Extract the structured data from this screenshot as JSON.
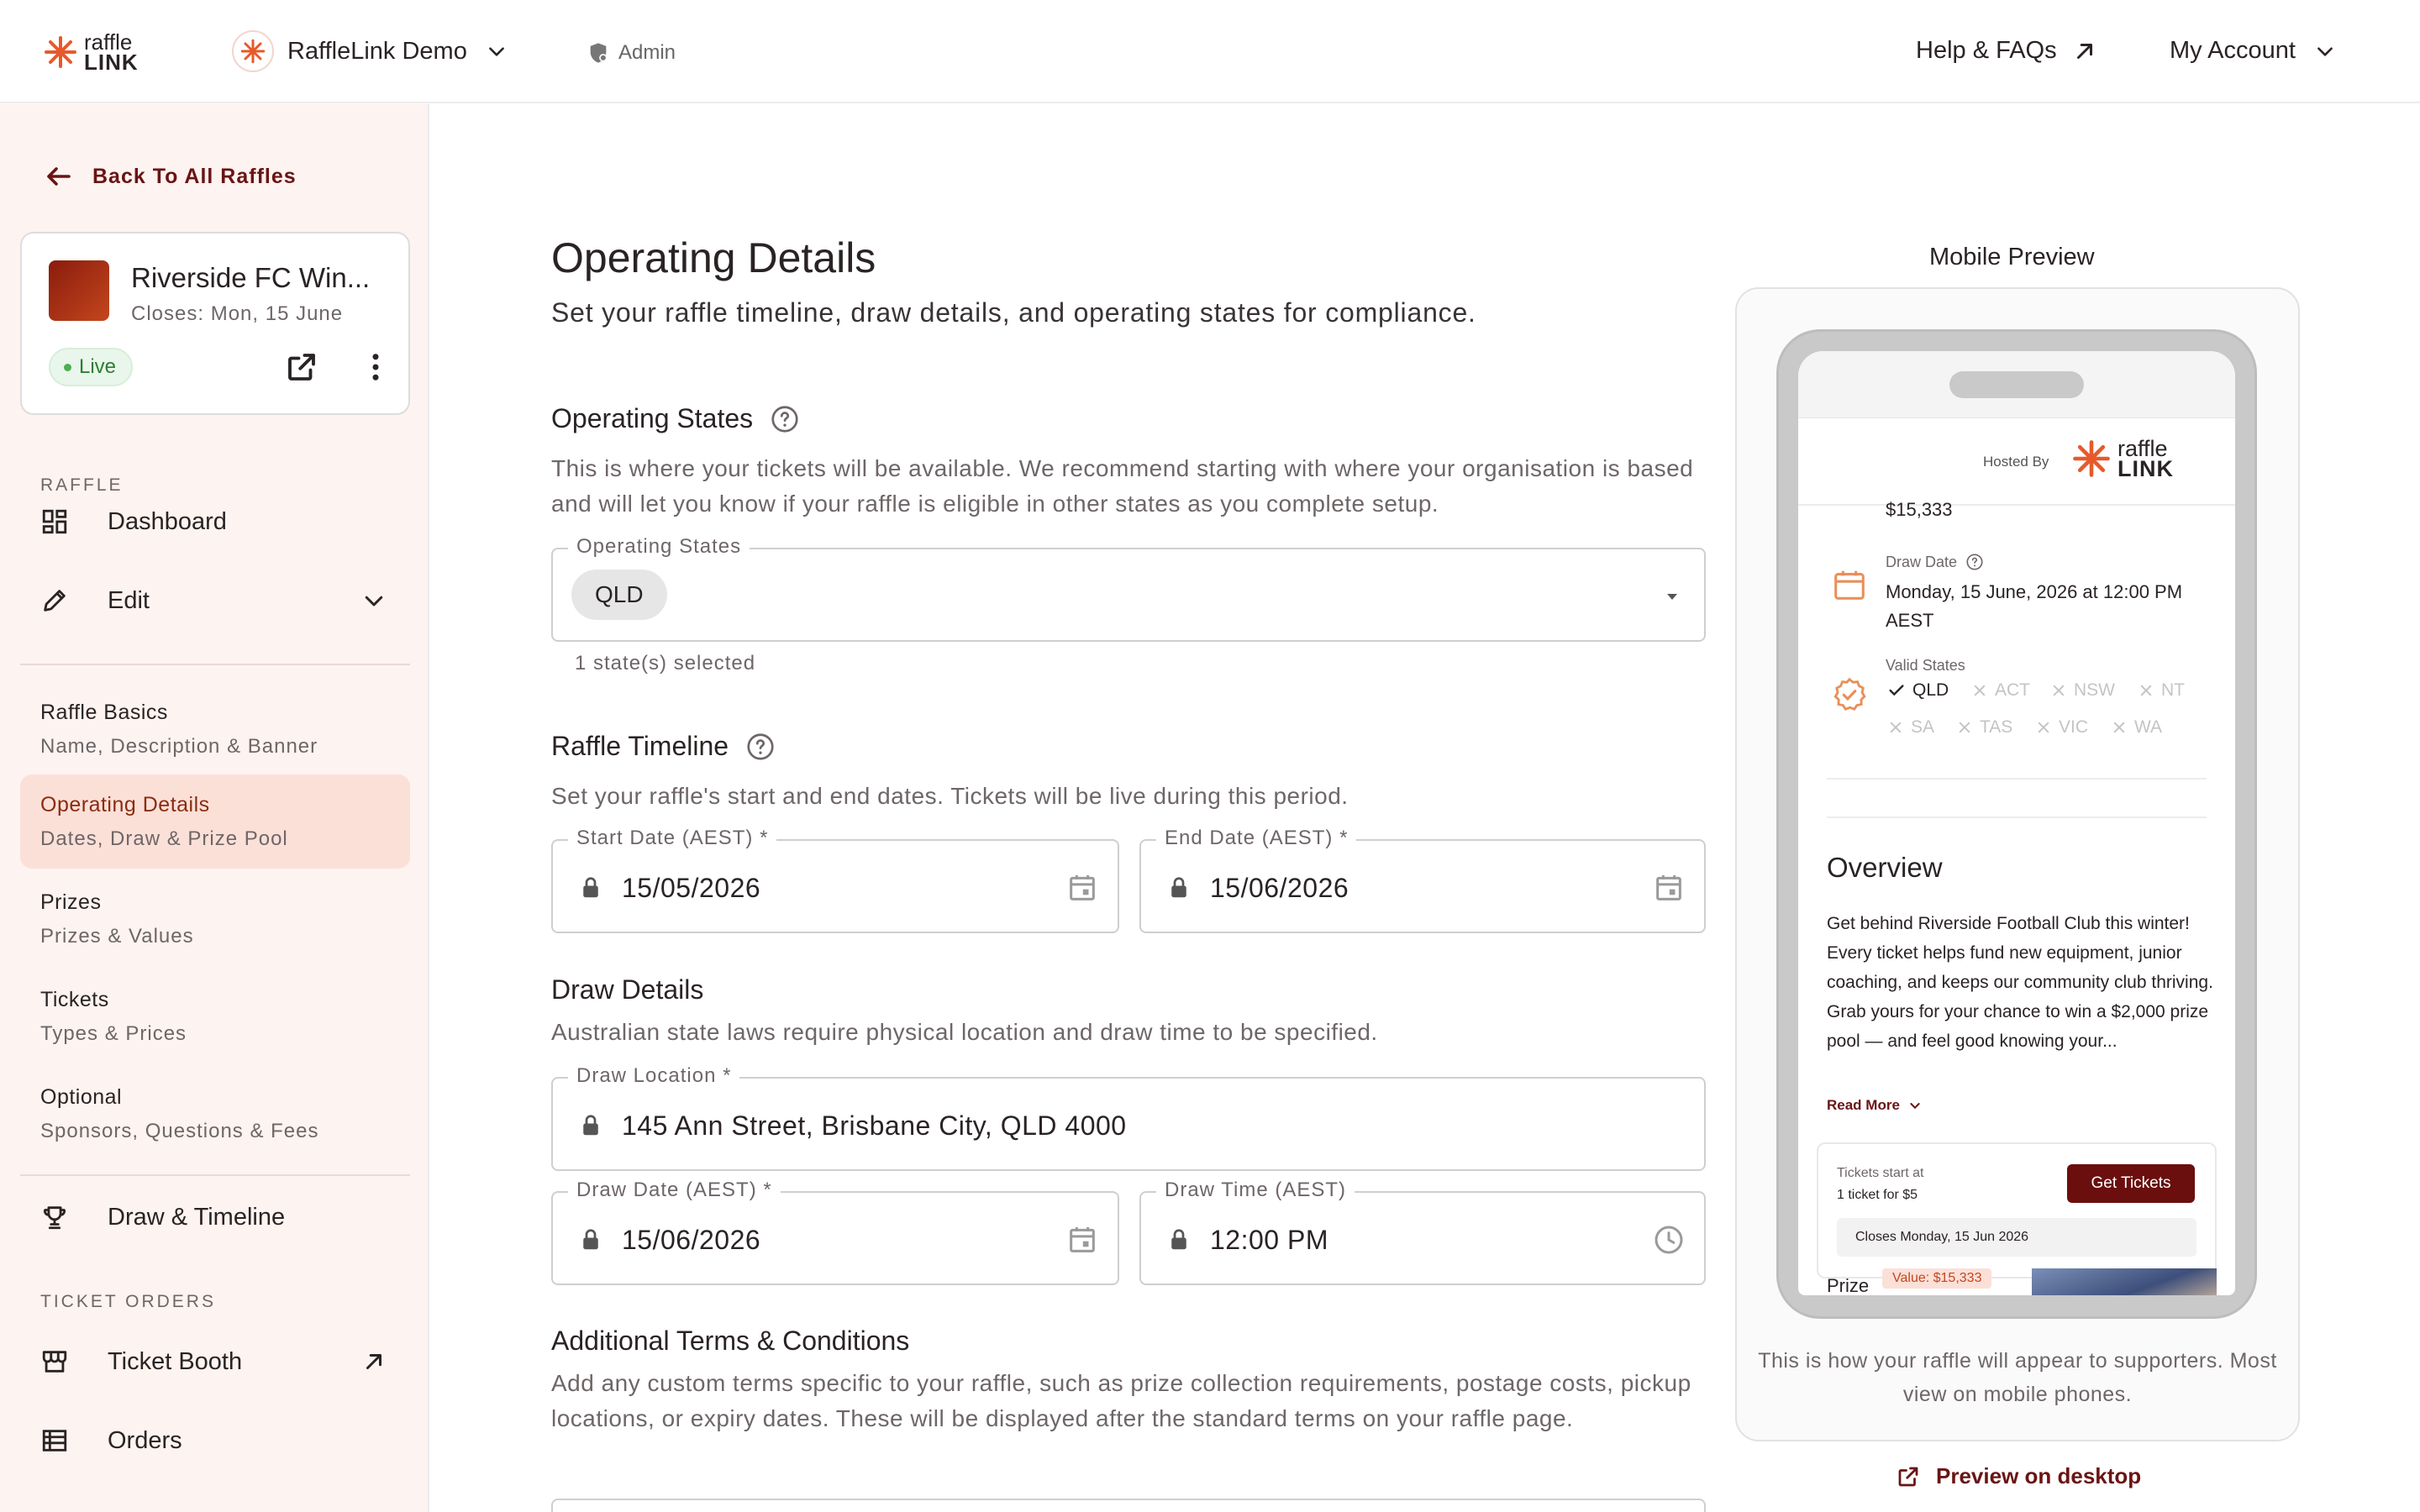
{
  "header": {
    "logo_line1": "raffle",
    "logo_line2": "LINK",
    "org_name": "RaffleLink Demo",
    "role": "Admin",
    "help": "Help & FAQs",
    "account": "My Account"
  },
  "sidebar": {
    "back": "Back To All Raffles",
    "raffle": {
      "title": "Riverside FC Win...",
      "closes": "Closes: Mon, 15 June",
      "status": "Live"
    },
    "section_raffle": "RAFFLE",
    "dashboard": "Dashboard",
    "edit": "Edit",
    "sub_items": [
      {
        "title": "Raffle Basics",
        "desc": "Name, Description & Banner"
      },
      {
        "title": "Operating Details",
        "desc": "Dates, Draw & Prize Pool"
      },
      {
        "title": "Prizes",
        "desc": "Prizes & Values"
      },
      {
        "title": "Tickets",
        "desc": "Types & Prices"
      },
      {
        "title": "Optional",
        "desc": "Sponsors, Questions & Fees"
      }
    ],
    "draw_timeline": "Draw & Timeline",
    "section_orders": "TICKET ORDERS",
    "ticket_booth": "Ticket Booth",
    "orders": "Orders"
  },
  "main": {
    "title": "Operating Details",
    "subtitle": "Set your raffle timeline, draw details, and operating states for compliance.",
    "operating_states": {
      "title": "Operating States",
      "desc": "This is where your tickets will be available. We recommend starting with where your organisation is based and will let you know if your raffle is eligible in other states as you complete setup.",
      "label": "Operating States",
      "chip": "QLD",
      "helper": "1 state(s) selected"
    },
    "timeline": {
      "title": "Raffle Timeline",
      "desc": "Set your raffle's start and end dates. Tickets will be live during this period.",
      "start_label": "Start Date (AEST)",
      "start_value": "15/05/2026",
      "end_label": "End Date (AEST)",
      "end_value": "15/06/2026"
    },
    "draw": {
      "title": "Draw Details",
      "desc": "Australian state laws require physical location and draw time to be specified.",
      "location_label": "Draw Location",
      "location_value": "145 Ann Street, Brisbane City, QLD 4000",
      "date_label": "Draw Date (AEST)",
      "date_value": "15/06/2026",
      "time_label": "Draw Time (AEST)",
      "time_value": "12:00 PM"
    },
    "terms": {
      "title": "Additional Terms & Conditions",
      "desc": "Add any custom terms specific to your raffle, such as prize collection requirements, postage costs, pickup locations, or expiry dates. These will be displayed after the standard terms on your raffle page."
    },
    "required_mark": "*"
  },
  "preview": {
    "title": "Mobile Preview",
    "hosted_by": "Hosted By",
    "prize_pool": "$15,333",
    "draw_date_label": "Draw Date",
    "draw_date_value": "Monday, 15 June, 2026 at 12:00 PM AEST",
    "valid_states_label": "Valid States",
    "states": [
      "QLD",
      "ACT",
      "NSW",
      "NT",
      "SA",
      "TAS",
      "VIC",
      "WA"
    ],
    "overview_title": "Overview",
    "overview_text": "Get behind Riverside Football Club this winter! Every ticket helps fund new equipment, junior coaching, and keeps our community club thriving. Grab yours for your chance to win a $2,000 prize pool — and feel good knowing your...",
    "read_more": "Read More",
    "tickets_start": "Tickets start at",
    "ticket_price": "1 ticket for $5",
    "get_tickets": "Get Tickets",
    "closes": "Closes Monday, 15 Jun 2026",
    "prize_label": "Prize",
    "prize_value": "Value: $15,333",
    "note": "This is how your raffle will appear to supporters. Most view on mobile phones.",
    "desktop_link": "Preview on desktop"
  },
  "colors": {
    "brand": "#e8592a",
    "accent_dark": "#6a0e0e",
    "sidebar_bg": "#fdf3f0",
    "active_bg": "#fbe0d8",
    "live_green": "#2e7d32"
  }
}
